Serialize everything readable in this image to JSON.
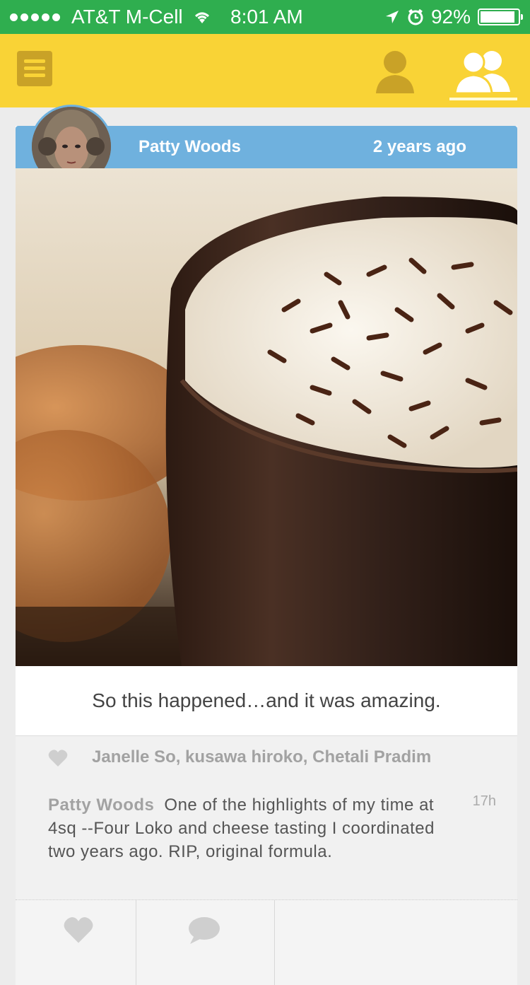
{
  "status_bar": {
    "carrier": "AT&T M-Cell",
    "time": "8:01 AM",
    "battery_percent": "92%",
    "battery_level": 0.92,
    "background": "#2fae4f"
  },
  "header": {
    "background": "#f9d336",
    "menu_icon": "hamburger-icon",
    "tabs": [
      {
        "icon": "person-icon",
        "selected": false
      },
      {
        "icon": "people-icon",
        "selected": true
      }
    ]
  },
  "post": {
    "author": "Patty Woods",
    "time": "2 years ago",
    "header_color": "#6fb1de",
    "caption": "So this happened…and it was amazing.",
    "likes": "Janelle So, kusawa hiroko, Chetali Pradim",
    "comment": {
      "author": "Patty Woods",
      "text": "One of the highlights of my time at 4sq --Four Loko and cheese tasting I coordinated two years ago. RIP, original formula.",
      "time": "17h"
    },
    "actions": [
      {
        "icon": "heart-icon"
      },
      {
        "icon": "comment-bubble-icon"
      }
    ]
  }
}
